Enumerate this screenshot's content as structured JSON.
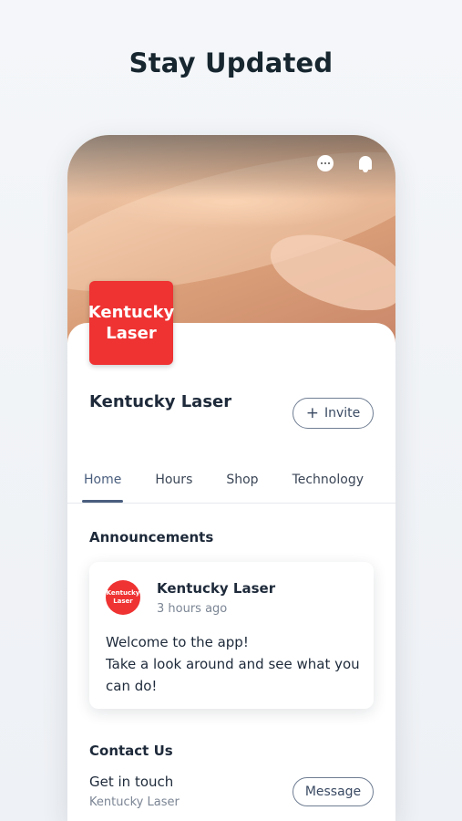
{
  "headline": "Stay Updated",
  "header": {
    "icons": [
      "chat-icon",
      "bell-icon"
    ]
  },
  "business": {
    "logo_line1": "Kentucky",
    "logo_line2": "Laser",
    "name": "Kentucky Laser",
    "invite_label": "Invite",
    "invite_icon": "plus-icon"
  },
  "tabs": [
    {
      "label": "Home",
      "active": true
    },
    {
      "label": "Hours",
      "active": false
    },
    {
      "label": "Shop",
      "active": false
    },
    {
      "label": "Technology",
      "active": false
    }
  ],
  "announcements": {
    "title": "Announcements",
    "post": {
      "avatar_line1": "Kentucky",
      "avatar_line2": "Laser",
      "author": "Kentucky Laser",
      "time": "3 hours ago",
      "line1": "Welcome to the app!",
      "line2": "Take a look around and see what you can do!"
    }
  },
  "contact": {
    "title": "Contact Us",
    "label": "Get in touch",
    "sub": "Kentucky Laser",
    "button": "Message"
  },
  "colors": {
    "brand_red": "#ef3232",
    "accent": "#4a5e7e"
  }
}
